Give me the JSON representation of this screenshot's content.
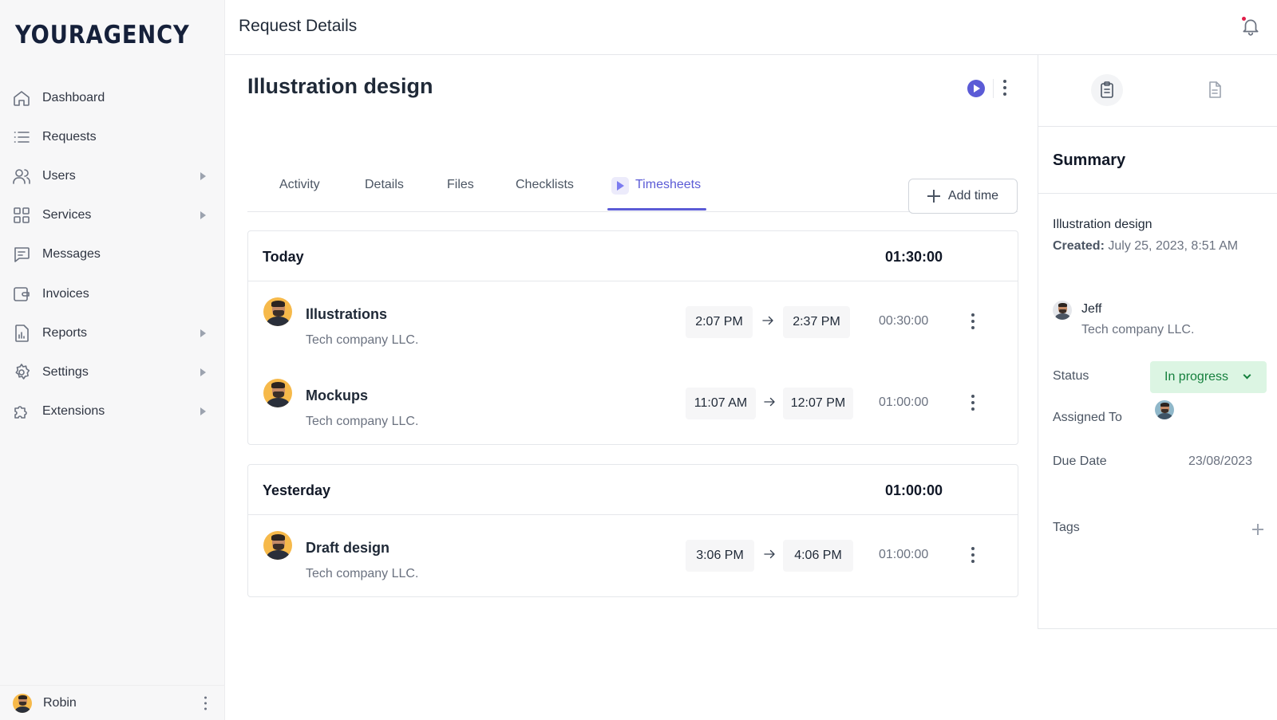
{
  "brand": {
    "logo": "YOURAGENCY"
  },
  "sidebar": {
    "items": [
      {
        "label": "Dashboard",
        "icon": "home-icon"
      },
      {
        "label": "Requests",
        "icon": "list-icon"
      },
      {
        "label": "Users",
        "icon": "users-icon",
        "expandable": true
      },
      {
        "label": "Services",
        "icon": "grid-icon",
        "expandable": true
      },
      {
        "label": "Messages",
        "icon": "message-icon"
      },
      {
        "label": "Invoices",
        "icon": "wallet-icon"
      },
      {
        "label": "Reports",
        "icon": "report-icon",
        "expandable": true
      },
      {
        "label": "Settings",
        "icon": "gear-icon",
        "expandable": true
      },
      {
        "label": "Extensions",
        "icon": "puzzle-icon",
        "expandable": true
      }
    ],
    "user": {
      "name": "Robin"
    }
  },
  "header": {
    "title": "Request Details"
  },
  "request": {
    "title": "Illustration design",
    "tabs": [
      "Activity",
      "Details",
      "Files",
      "Checklists",
      "Timesheets"
    ],
    "active_tab": "Timesheets",
    "add_time_label": "Add time"
  },
  "timesheets": {
    "groups": [
      {
        "label": "Today",
        "total": "01:30:00",
        "entries": [
          {
            "name": "Illustrations",
            "company": "Tech company LLC.",
            "start": "2:07 PM",
            "end": "2:37 PM",
            "duration": "00:30:00"
          },
          {
            "name": "Mockups",
            "company": "Tech company LLC.",
            "start": "11:07 AM",
            "end": "12:07 PM",
            "duration": "01:00:00"
          }
        ]
      },
      {
        "label": "Yesterday",
        "total": "01:00:00",
        "entries": [
          {
            "name": "Draft design",
            "company": "Tech company LLC.",
            "start": "3:06 PM",
            "end": "4:06 PM",
            "duration": "01:00:00"
          }
        ]
      }
    ]
  },
  "summary": {
    "heading": "Summary",
    "request_name": "Illustration design",
    "created_label": "Created:",
    "created_value": "July 25, 2023, 8:51 AM",
    "client_name": "Jeff",
    "client_company": "Tech company LLC.",
    "status_label": "Status",
    "status_value": "In progress",
    "assigned_label": "Assigned To",
    "due_label": "Due Date",
    "due_value": "23/08/2023",
    "tags_label": "Tags"
  },
  "colors": {
    "accent": "#5b5bd6",
    "status_bg": "#dcf5e3",
    "status_text": "#15803d"
  }
}
